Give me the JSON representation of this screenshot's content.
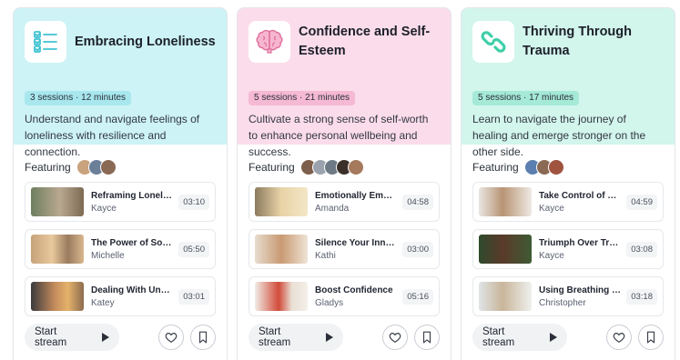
{
  "common": {
    "featuring_label": "Featuring",
    "start_label": "Start stream"
  },
  "cards": [
    {
      "title": "Embracing Loneliness",
      "meta": "3 sessions · 12 minutes",
      "description": "Understand and navigate feelings of loneliness with resilience and connection.",
      "icon": "checklist-icon",
      "accent": "#cdf3f6",
      "pill": "#a8e7ee",
      "strip": "#5fd3de",
      "tracks": [
        {
          "title": "Reframing Lonelin...",
          "author": "Kayce",
          "duration": "03:10"
        },
        {
          "title": "The Power of Soci...",
          "author": "Michelle",
          "duration": "05:50"
        },
        {
          "title": "Dealing With Unco...",
          "author": "Katey",
          "duration": "03:01"
        }
      ]
    },
    {
      "title": "Confidence and Self-Esteem",
      "meta": "5 sessions · 21 minutes",
      "description": "Cultivate a strong sense of self-worth to enhance personal wellbeing and success.",
      "icon": "brain-icon",
      "accent": "#fbdcea",
      "pill": "#f5b9d3",
      "strip": "#ec6fa4",
      "tracks": [
        {
          "title": "Emotionally Empo...",
          "author": "Amanda",
          "duration": "04:58"
        },
        {
          "title": "Silence Your Inner ...",
          "author": "Kathi",
          "duration": "03:00"
        },
        {
          "title": "Boost Confidence",
          "author": "Gladys",
          "duration": "05:16"
        }
      ]
    },
    {
      "title": "Thriving Through Trauma",
      "meta": "5 sessions · 17 minutes",
      "description": "Learn to navigate the journey of healing and emerge stronger on the other side.",
      "icon": "link-icon",
      "accent": "#d2f5ec",
      "pill": "#a5e9d7",
      "strip": "#3fcfa9",
      "tracks": [
        {
          "title": "Take Control of Yo...",
          "author": "Kayce",
          "duration": "04:59"
        },
        {
          "title": "Triumph Over Trau...",
          "author": "Kayce",
          "duration": "03:08"
        },
        {
          "title": "Using Breathing to...",
          "author": "Christopher",
          "duration": "03:18"
        }
      ]
    }
  ]
}
